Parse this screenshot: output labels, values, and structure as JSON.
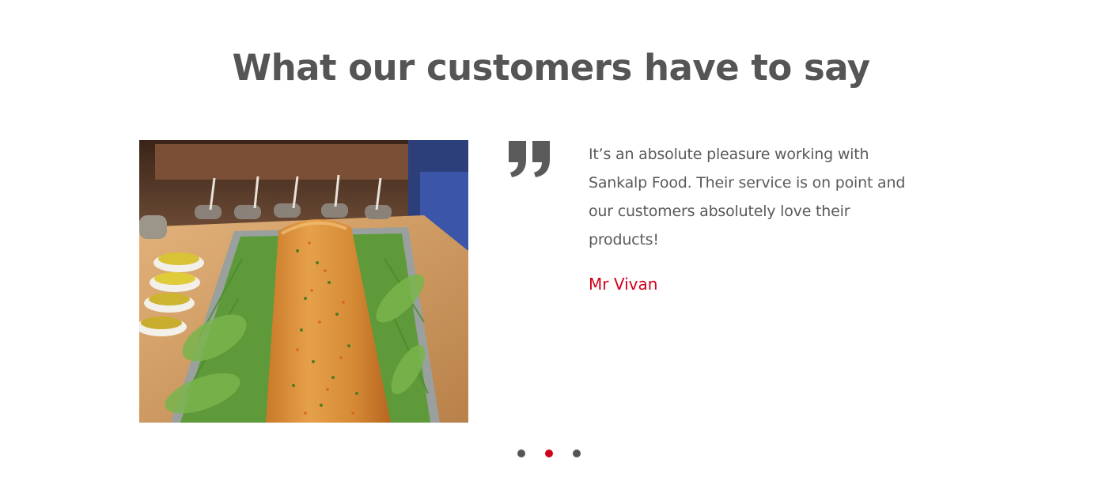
{
  "section": {
    "title": "What our customers have to say"
  },
  "testimonial": {
    "image_icon": "dosa-food-photo",
    "quote_icon": "closing-quote-icon",
    "text": "It’s an absolute pleasure working with Sankalp Food. Their service is on point and our customers absolutely love their products!",
    "author": "Mr Vivan"
  },
  "carousel": {
    "slide_count": 3,
    "active_index": 1
  },
  "colors": {
    "heading": "#555555",
    "body_text": "#5a5a5a",
    "accent": "#d0021b",
    "dot_inactive": "#555555",
    "dot_active": "#d0021b"
  }
}
